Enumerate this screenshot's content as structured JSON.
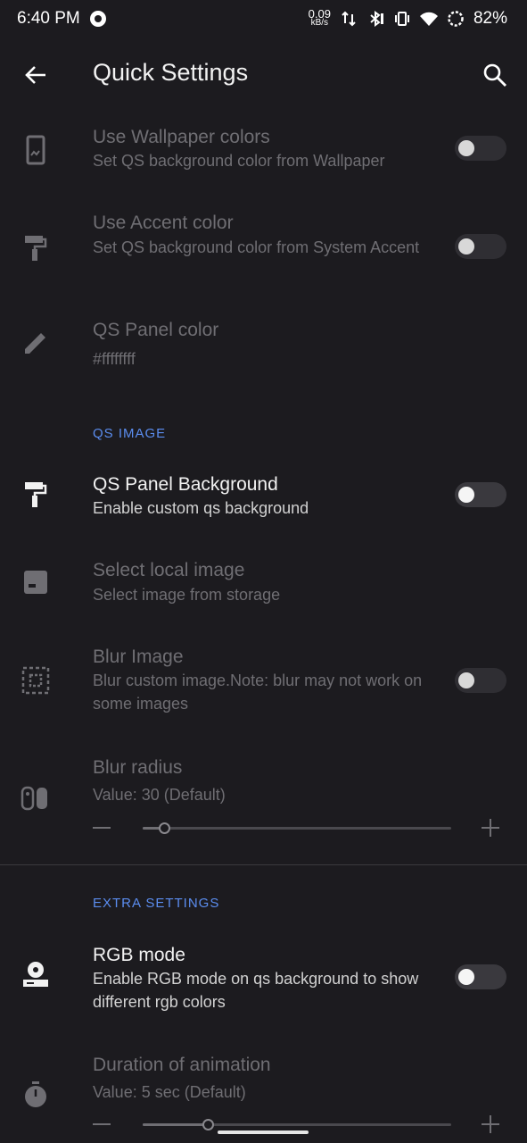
{
  "status": {
    "time": "6:40 PM",
    "speed_value": "0.09",
    "speed_unit": "kB/s",
    "battery": "82%"
  },
  "appbar": {
    "title": "Quick Settings"
  },
  "prefs": {
    "wallpaper": {
      "title": "Use Wallpaper colors",
      "summary": "Set QS background color from Wallpaper",
      "checked": false
    },
    "accent": {
      "title": "Use Accent color",
      "summary": "Set QS background color from System Accent",
      "checked": false
    },
    "panel_color": {
      "title": "QS Panel color",
      "summary": "#ffffffff"
    },
    "panel_bg": {
      "title": "QS Panel Background",
      "summary": "Enable custom qs background",
      "checked": false
    },
    "local_image": {
      "title": "Select local image",
      "summary": "Select image from storage"
    },
    "blur_image": {
      "title": "Blur Image",
      "summary": "Blur custom image.Note: blur may not work on some images",
      "checked": false
    },
    "blur_radius": {
      "title": "Blur radius",
      "summary": "Value: 30  (Default)",
      "value_fraction": 0.07
    },
    "rgb": {
      "title": "RGB mode",
      "summary": "Enable RGB mode on qs background to show different rgb colors",
      "checked": false
    },
    "duration": {
      "title": "Duration of animation",
      "summary": "Value: 5 sec (Default)",
      "value_fraction": 0.21
    }
  },
  "sections": {
    "qs_image": "QS IMAGE",
    "extra": "EXTRA SETTINGS"
  },
  "colors": {
    "background": "#1c1b1f",
    "accent": "#5b8def"
  }
}
